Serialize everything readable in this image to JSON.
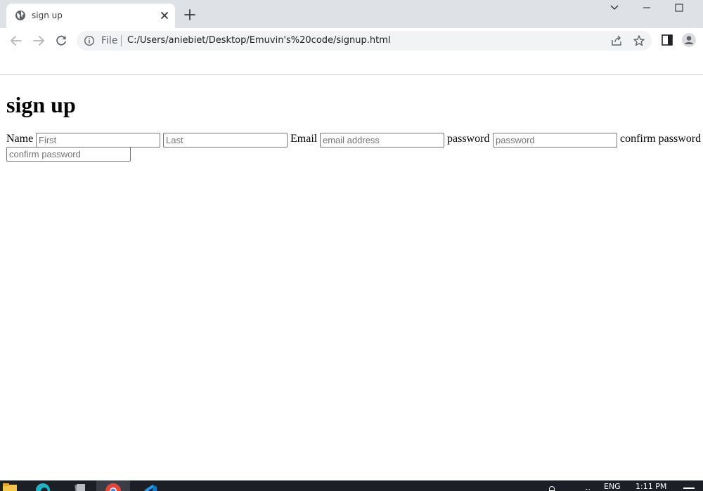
{
  "browser": {
    "tab": {
      "title": "sign up",
      "icon": "globe-icon"
    },
    "address_bar": {
      "scheme_label": "File",
      "url": "C:/Users/aniebiet/Desktop/Emuvin's%20code/signup.html"
    }
  },
  "page": {
    "heading": "sign up",
    "form": {
      "name_label": "Name",
      "first_placeholder": "First",
      "last_placeholder": "Last",
      "email_label": "Email",
      "email_placeholder": "email address",
      "password_label": "password",
      "password_placeholder": "password",
      "confirm_label": "confirm password",
      "confirm_placeholder": "confirm password"
    }
  },
  "taskbar": {
    "language": "ENG",
    "time": "1:11 PM"
  },
  "colors": {
    "titlebar": "#dee1e6",
    "omnibox": "#f1f3f4",
    "taskbar": "#1c1f26",
    "chrome_red": "#ea4335",
    "edge_teal": "#1fb3c4",
    "vscode_blue": "#0a7ad1"
  }
}
